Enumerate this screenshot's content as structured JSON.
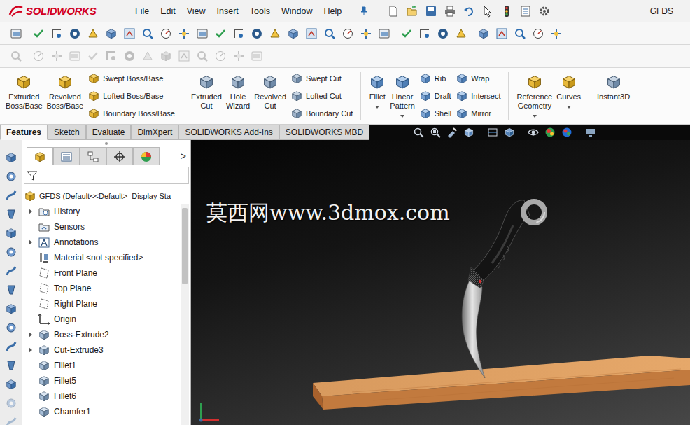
{
  "window": {
    "title": "GFDS"
  },
  "logo": {
    "text": "SOLIDWORKS"
  },
  "menu": [
    {
      "label": "File"
    },
    {
      "label": "Edit"
    },
    {
      "label": "View"
    },
    {
      "label": "Insert"
    },
    {
      "label": "Tools"
    },
    {
      "label": "Window"
    },
    {
      "label": "Help"
    }
  ],
  "toolbars": [
    {
      "disabled": false
    },
    {
      "disabled": true
    }
  ],
  "ribbon": [
    {
      "kind": "big",
      "label": "Extruded\nBoss/Base",
      "dropdown": false
    },
    {
      "kind": "big",
      "label": "Revolved\nBoss/Base",
      "dropdown": false
    },
    {
      "kind": "stack",
      "items": [
        {
          "label": "Swept Boss/Base"
        },
        {
          "label": "Lofted Boss/Base"
        },
        {
          "label": "Boundary Boss/Base"
        }
      ]
    },
    {
      "kind": "separator"
    },
    {
      "kind": "big",
      "label": "Extruded\nCut",
      "dropdown": false
    },
    {
      "kind": "big",
      "label": "Hole\nWizard",
      "dropdown": false
    },
    {
      "kind": "big",
      "label": "Revolved\nCut",
      "dropdown": false
    },
    {
      "kind": "stack",
      "items": [
        {
          "label": "Swept Cut"
        },
        {
          "label": "Lofted Cut"
        },
        {
          "label": "Boundary Cut"
        }
      ]
    },
    {
      "kind": "separator"
    },
    {
      "kind": "big",
      "label": "Fillet",
      "dropdown": true
    },
    {
      "kind": "big",
      "label": "Linear\nPattern",
      "dropdown": true
    },
    {
      "kind": "stack",
      "items": [
        {
          "label": "Rib"
        },
        {
          "label": "Draft"
        },
        {
          "label": "Shell"
        }
      ]
    },
    {
      "kind": "stack",
      "items": [
        {
          "label": "Wrap"
        },
        {
          "label": "Intersect"
        },
        {
          "label": "Mirror"
        }
      ]
    },
    {
      "kind": "separator"
    },
    {
      "kind": "big",
      "label": "Reference\nGeometry",
      "dropdown": true
    },
    {
      "kind": "big",
      "label": "Curves",
      "dropdown": true
    },
    {
      "kind": "separator"
    },
    {
      "kind": "big",
      "label": "Instant3D",
      "dropdown": false
    }
  ],
  "tabs": [
    {
      "label": "Features",
      "selected": true
    },
    {
      "label": "Sketch",
      "selected": false
    },
    {
      "label": "Evaluate",
      "selected": false
    },
    {
      "label": "DimXpert",
      "selected": false
    },
    {
      "label": "SOLIDWORKS Add-Ins",
      "selected": false
    },
    {
      "label": "SOLIDWORKS MBD",
      "selected": false
    }
  ],
  "panel": {
    "tabs": [
      {
        "selected": true
      },
      {
        "selected": false
      },
      {
        "selected": false
      },
      {
        "selected": false
      },
      {
        "selected": false
      }
    ],
    "more": ">",
    "root": "GFDS (Default<<Default>_Display Sta",
    "scrollbar": {
      "level": 0.35
    }
  },
  "tree": [
    {
      "label": "History",
      "kind": "history",
      "has_children": true,
      "expanded": false
    },
    {
      "label": "Sensors",
      "kind": "sensor",
      "has_children": false,
      "expanded": false
    },
    {
      "label": "Annotations",
      "kind": "annotation",
      "has_children": true,
      "expanded": false
    },
    {
      "label": "Material <not specified>",
      "kind": "material",
      "has_children": false,
      "expanded": false
    },
    {
      "label": "Front Plane",
      "kind": "plane",
      "has_children": false,
      "expanded": false
    },
    {
      "label": "Top Plane",
      "kind": "plane",
      "has_children": false,
      "expanded": false
    },
    {
      "label": "Right Plane",
      "kind": "plane",
      "has_children": false,
      "expanded": false
    },
    {
      "label": "Origin",
      "kind": "origin",
      "has_children": false,
      "expanded": false
    },
    {
      "label": "Boss-Extrude2",
      "kind": "feature",
      "has_children": true,
      "expanded": false
    },
    {
      "label": "Cut-Extrude3",
      "kind": "feature",
      "has_children": true,
      "expanded": false
    },
    {
      "label": "Fillet1",
      "kind": "feature",
      "has_children": false,
      "expanded": false
    },
    {
      "label": "Fillet5",
      "kind": "feature",
      "has_children": false,
      "expanded": false
    },
    {
      "label": "Fillet6",
      "kind": "feature",
      "has_children": false,
      "expanded": false
    },
    {
      "label": "Chamfer1",
      "kind": "feature",
      "has_children": false,
      "expanded": false
    }
  ],
  "viewport": {
    "watermark": "莫西网www.3dmox.com"
  }
}
